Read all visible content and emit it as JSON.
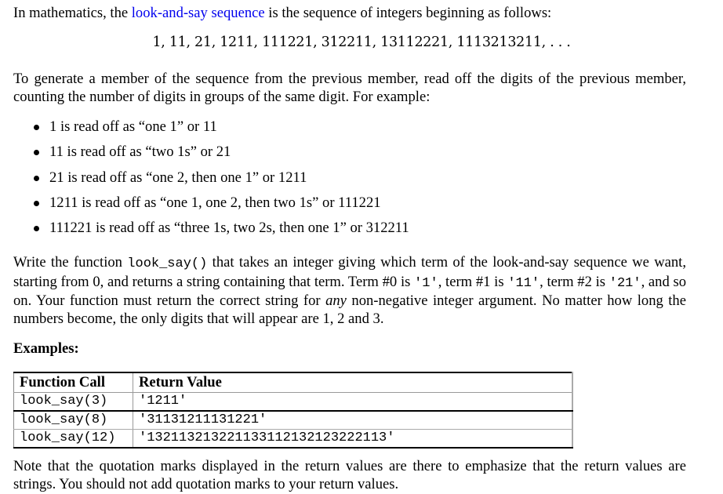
{
  "intro": {
    "before_link": "In mathematics, the ",
    "link_text": "look-and-say sequence",
    "after_link": " is the sequence of integers beginning as follows:"
  },
  "sequence": "1, 11, 21, 1211, 111221, 312211, 13112221, 1113213211, . . .",
  "generate_paragraph": "To generate a member of the sequence from the previous member, read off the digits of the previous member, counting the number of digits in groups of the same digit. For example:",
  "bullets": [
    "1 is read off as “one 1” or 11",
    "11 is read off as “two 1s” or 21",
    "21 is read off as “one 2, then one 1” or 1211",
    "1211 is read off as “one 1, one 2, then two 1s” or 111221",
    "111221 is read off as “three 1s, two 2s, then one 1” or 312211"
  ],
  "write_paragraph": {
    "t1": "Write the function ",
    "code_fn": "look_say()",
    "t2": " that takes an integer giving which term of the look-and-say sequence we want, starting from 0, and returns a string containing that term. Term #0 is ",
    "code_t0": "'1'",
    "t3": ", term #1 is ",
    "code_t1": "'11'",
    "t4": ", term #2 is ",
    "code_t2": "'21'",
    "t5": ", and so on.  Your function must return the correct string for ",
    "emph": "any",
    "t6": " non-negative integer argument.  No matter how long the numbers become, the only digits that will appear are 1, 2 and 3."
  },
  "examples_heading": "Examples:",
  "examples_table": {
    "headers": [
      "Function Call",
      "Return Value"
    ],
    "rows": [
      [
        "look_say(3)",
        "'1211'"
      ],
      [
        "look_say(8)",
        "'31131211131221'"
      ],
      [
        "look_say(12)",
        "'132113213221133112132123222113'"
      ]
    ]
  },
  "note": "Note that the quotation marks displayed in the return values are there to emphasize that the return values are strings. You should not add quotation marks to your return values."
}
